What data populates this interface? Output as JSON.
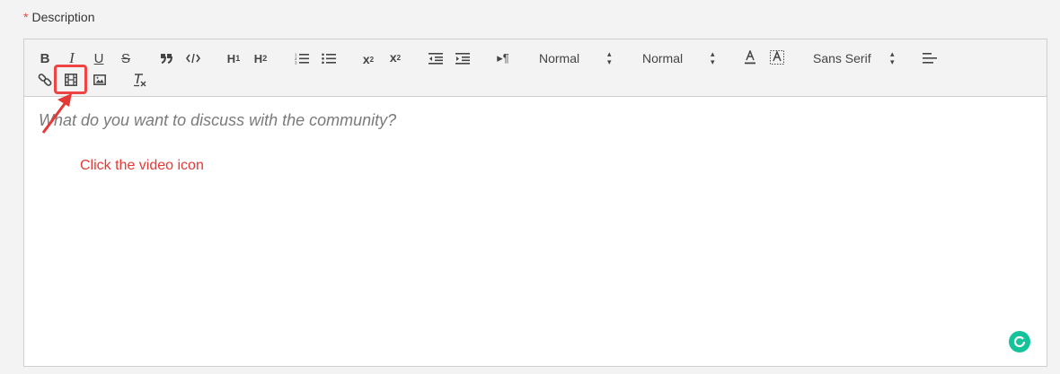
{
  "field": {
    "required_mark": "*",
    "label": "Description"
  },
  "toolbar": {
    "header1": "H",
    "header1_sub": "1",
    "header2": "H",
    "header2_sub": "2",
    "bold": "B",
    "italic": "I",
    "underline": "U",
    "strike": "S",
    "subscript": "x",
    "subscript_sub": "2",
    "superscript": "x",
    "superscript_sup": "2",
    "direction": "▸¶",
    "size_select": "Normal",
    "header_select": "Normal",
    "font_select": "Sans Serif"
  },
  "editor": {
    "placeholder": "What do you want to discuss with the community?"
  },
  "annotation": {
    "text": "Click the video icon",
    "color": "#e53935"
  },
  "colors": {
    "accent_red": "#ef4444",
    "grammarly": "#15c39a"
  }
}
